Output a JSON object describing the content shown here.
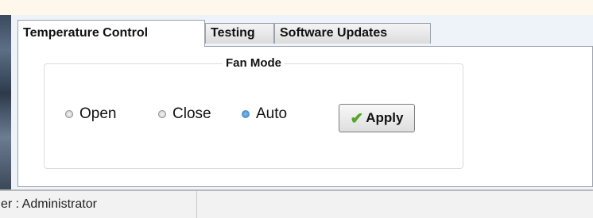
{
  "tabs": [
    {
      "label": "Temperature Control",
      "active": true
    },
    {
      "label": "Testing",
      "active": false
    },
    {
      "label": "Software Updates",
      "active": false
    }
  ],
  "fan_mode": {
    "title": "Fan Mode",
    "options": [
      {
        "label": "Open",
        "checked": false
      },
      {
        "label": "Close",
        "checked": false
      },
      {
        "label": "Auto",
        "checked": true
      }
    ],
    "apply_label": "Apply",
    "apply_icon": "check-icon"
  },
  "status": {
    "user_text": "er  :  Administrator"
  },
  "colors": {
    "checked_radio": "#3a86c8",
    "check_icon": "#55a62a"
  }
}
